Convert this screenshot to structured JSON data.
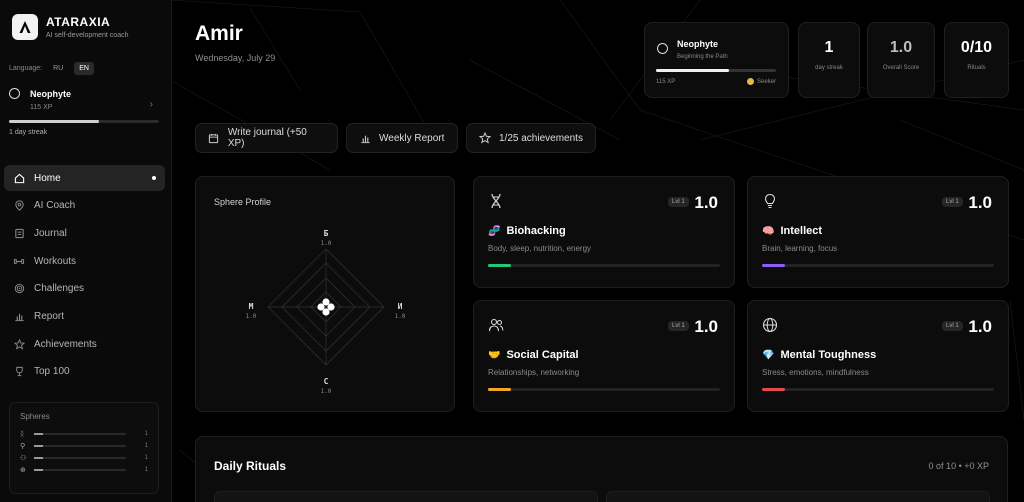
{
  "brand": {
    "name": "ATARAXIA",
    "tagline": "AI self-development coach"
  },
  "language": {
    "label": "Language:",
    "options": [
      "RU",
      "EN"
    ],
    "selected": "EN"
  },
  "profile": {
    "rank": "Neophyte",
    "xp": "115 XP",
    "streak": "1 day streak",
    "xp_progress": 0.6
  },
  "nav": [
    {
      "label": "Home",
      "icon": "home-icon",
      "active": true
    },
    {
      "label": "AI Coach",
      "icon": "compass-icon"
    },
    {
      "label": "Journal",
      "icon": "journal-icon"
    },
    {
      "label": "Workouts",
      "icon": "dumbbell-icon"
    },
    {
      "label": "Challenges",
      "icon": "target-icon"
    },
    {
      "label": "Report",
      "icon": "bar-chart-icon"
    },
    {
      "label": "Achievements",
      "icon": "star-icon"
    },
    {
      "label": "Top 100",
      "icon": "trophy-icon"
    }
  ],
  "spheres_panel": {
    "title": "Spheres",
    "rows": [
      {
        "icon": "dna-icon",
        "value": "1"
      },
      {
        "icon": "bulb-icon",
        "value": "1"
      },
      {
        "icon": "people-icon",
        "value": "1"
      },
      {
        "icon": "globe-icon",
        "value": "1"
      }
    ]
  },
  "header": {
    "greeting": "Amir",
    "date": "Wednesday, July 29"
  },
  "level_card": {
    "rank": "Neophyte",
    "subtitle": "Beginning the Path",
    "xp": "115 XP",
    "next_rank": "Seeker",
    "progress": 0.61
  },
  "stats": [
    {
      "value": "1",
      "label": "day streak",
      "dim": false
    },
    {
      "value": "1.0",
      "label": "Overall Score",
      "dim": true
    },
    {
      "value": "0/10",
      "label": "Rituals",
      "dim": false
    }
  ],
  "actions": [
    {
      "label": "Write journal (+50 XP)",
      "icon": "journal-icon"
    },
    {
      "label": "Weekly Report",
      "icon": "bar-chart-icon"
    },
    {
      "label": "1/25 achievements",
      "icon": "star-icon"
    }
  ],
  "sphere_profile": {
    "title": "Sphere Profile",
    "axes": [
      {
        "label": "Б",
        "value": "1.0"
      },
      {
        "label": "И",
        "value": "1.0"
      },
      {
        "label": "С",
        "value": "1.0"
      },
      {
        "label": "М",
        "value": "1.0"
      }
    ]
  },
  "sphere_cards": [
    {
      "name": "Biohacking",
      "emoji": "🧬",
      "icon": "dna-icon",
      "level": "Lvl 1",
      "score": "1.0",
      "desc": "Body, sleep, nutrition, energy",
      "color": "#22c77a",
      "progress": 0.1
    },
    {
      "name": "Intellect",
      "emoji": "🧠",
      "icon": "bulb-icon",
      "level": "Lvl 1",
      "score": "1.0",
      "desc": "Brain, learning, focus",
      "color": "#8b5cf6",
      "progress": 0.1
    },
    {
      "name": "Social Capital",
      "emoji": "🤝",
      "icon": "people-icon",
      "level": "Lvl 1",
      "score": "1.0",
      "desc": "Relationships, networking",
      "color": "#f5a524",
      "progress": 0.1
    },
    {
      "name": "Mental Toughness",
      "emoji": "💎",
      "icon": "globe-icon",
      "level": "Lvl 1",
      "score": "1.0",
      "desc": "Stress, emotions, mindfulness",
      "color": "#e5484d",
      "progress": 0.1
    }
  ],
  "rituals": {
    "title": "Daily Rituals",
    "count": "0 of 10 • +0 XP"
  }
}
